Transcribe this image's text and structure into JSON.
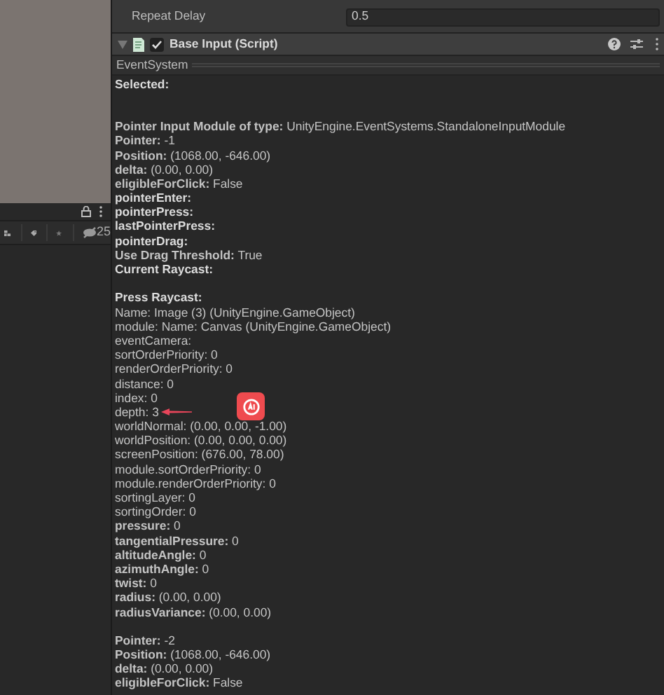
{
  "hierarchy_toolbar": {
    "count": "25"
  },
  "inspector": {
    "fields": [
      {
        "label": "Repeat Delay",
        "value": "0.5"
      }
    ],
    "component": {
      "title": "Base Input (Script)",
      "enabled": true,
      "expanded": true
    },
    "section": "EventSystem",
    "lines": [
      {
        "text": "Selected:",
        "bold": true
      },
      {
        "kind": "blank"
      },
      {
        "kind": "blank"
      },
      {
        "text": "**Pointer Input Module of type:** UnityEngine.EventSystems.StandaloneInputModule"
      },
      {
        "text": "**Pointer:** -1"
      },
      {
        "text": "**Position:** (1068.00, -646.00)"
      },
      {
        "text": "**delta:** (0.00, 0.00)"
      },
      {
        "text": "**eligibleForClick:** False"
      },
      {
        "text": "pointerEnter:",
        "bold": true
      },
      {
        "text": "pointerPress:",
        "bold": true
      },
      {
        "text": "lastPointerPress:",
        "bold": true
      },
      {
        "text": "pointerDrag:",
        "bold": true
      },
      {
        "text": "**Use Drag Threshold:** True"
      },
      {
        "text": "Current Raycast:",
        "bold": true
      },
      {
        "kind": "blank"
      },
      {
        "text": "Press Raycast:",
        "bold": true
      },
      {
        "text": "Name: Image (3) (UnityEngine.GameObject)"
      },
      {
        "text": "module: Name: Canvas (UnityEngine.GameObject)"
      },
      {
        "text": "eventCamera:"
      },
      {
        "text": "sortOrderPriority: 0"
      },
      {
        "text": "renderOrderPriority: 0"
      },
      {
        "text": "distance: 0"
      },
      {
        "text": "index: 0"
      },
      {
        "text": "depth: 3",
        "kind": "marked"
      },
      {
        "text": "worldNormal: (0.00, 0.00, -1.00)"
      },
      {
        "text": "worldPosition: (0.00, 0.00, 0.00)"
      },
      {
        "text": "screenPosition: (676.00, 78.00)"
      },
      {
        "text": "module.sortOrderPriority: 0"
      },
      {
        "text": "module.renderOrderPriority: 0"
      },
      {
        "text": "sortingLayer: 0"
      },
      {
        "text": "sortingOrder: 0"
      },
      {
        "text": "**pressure:** 0"
      },
      {
        "text": "**tangentialPressure:** 0"
      },
      {
        "text": "**altitudeAngle:** 0"
      },
      {
        "text": "**azimuthAngle:** 0"
      },
      {
        "text": "**twist:** 0"
      },
      {
        "text": "**radius:** (0.00, 0.00)"
      },
      {
        "text": "**radiusVariance:** (0.00, 0.00)"
      },
      {
        "kind": "blank"
      },
      {
        "text": "**Pointer:** -2"
      },
      {
        "text": "**Position:** (1068.00, -646.00)"
      },
      {
        "text": "**delta:** (0.00, 0.00)"
      },
      {
        "text": "**eligibleForClick:** False"
      }
    ]
  }
}
